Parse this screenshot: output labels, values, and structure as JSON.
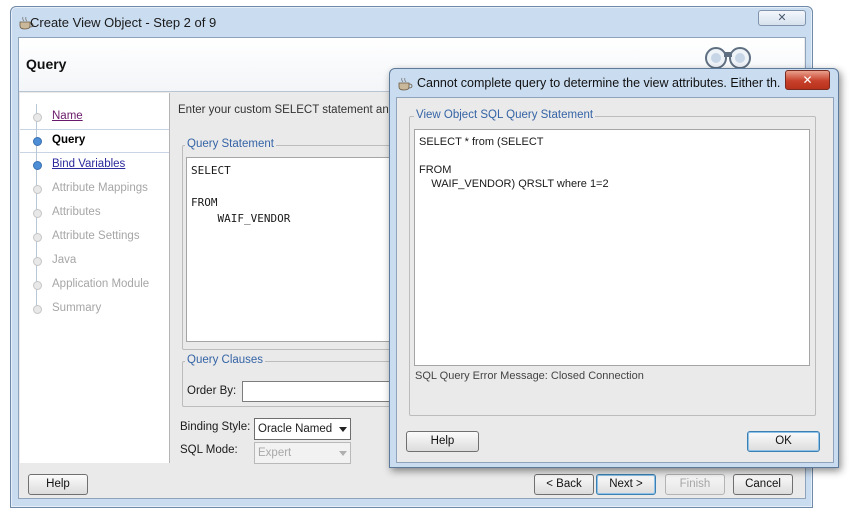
{
  "main_window": {
    "title": "Create View Object - Step 2 of 9",
    "close_symbol": "✕",
    "header_title": "Query",
    "header_icon": "binoculars-icon"
  },
  "sidebar": {
    "steps": [
      {
        "label": "Name",
        "state": "visited"
      },
      {
        "label": "Query",
        "state": "current"
      },
      {
        "label": "Bind Variables",
        "state": "link"
      },
      {
        "label": "Attribute Mappings",
        "state": "disabled"
      },
      {
        "label": "Attributes",
        "state": "disabled"
      },
      {
        "label": "Attribute Settings",
        "state": "disabled"
      },
      {
        "label": "Java",
        "state": "disabled"
      },
      {
        "label": "Application Module",
        "state": "disabled"
      },
      {
        "label": "Summary",
        "state": "disabled"
      }
    ]
  },
  "content": {
    "instruction": "Enter your custom SELECT statement and cl",
    "query_statement_label": "Query Statement",
    "query_text": "SELECT\n\nFROM\n    WAIF_VENDOR",
    "query_clauses_label": "Query Clauses",
    "order_by_label": "Order By:",
    "order_by_value": "",
    "binding_style_label": "Binding Style:",
    "binding_style_value": "Oracle Named",
    "sql_mode_label": "SQL Mode:",
    "sql_mode_value": "Expert"
  },
  "footer": {
    "help": "Help",
    "back": "< Back",
    "next": "Next >",
    "finish": "Finish",
    "cancel": "Cancel"
  },
  "error_dialog": {
    "title": "Cannot complete query to determine the view attributes.  Either th...",
    "close_symbol": "✕",
    "group_label": "View Object SQL Query Statement",
    "sql_text": "SELECT * from (SELECT\n\nFROM\n    WAIF_VENDOR) QRSLT where 1=2",
    "error_message": "SQL Query Error Message: Closed Connection",
    "help": "Help",
    "ok": "OK"
  }
}
